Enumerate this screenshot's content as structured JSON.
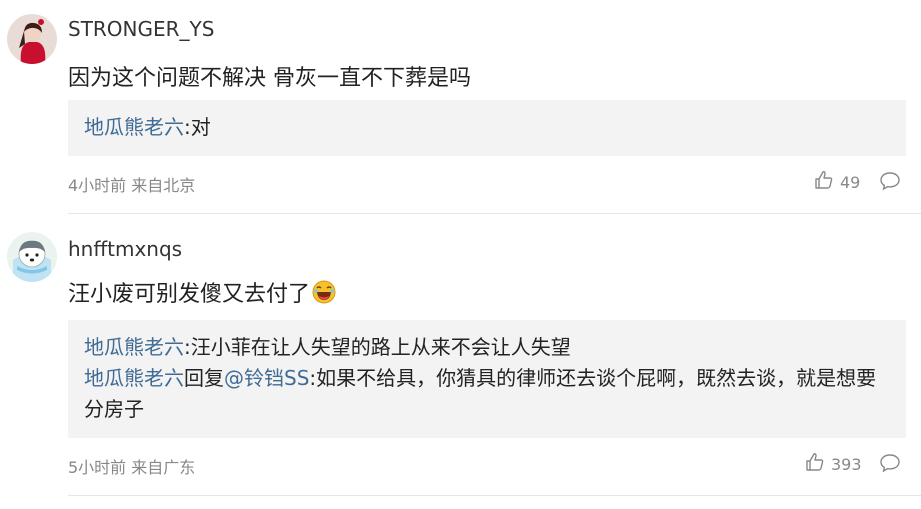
{
  "comments": [
    {
      "username": "STRONGER_YS",
      "text": "因为这个问题不解决 骨灰一直不下葬是吗",
      "replies": [
        {
          "author": "地瓜熊老六",
          "sep": ":",
          "text": "对"
        }
      ],
      "time": "4小时前",
      "location": "来自北京",
      "likes": "49"
    },
    {
      "username": "hnfftmxnqs",
      "text": "汪小废可别发傻又去付了",
      "replies": [
        {
          "author": "地瓜熊老六",
          "sep": ":",
          "text": "汪小菲在让人失望的路上从来不会让人失望"
        },
        {
          "author": "地瓜熊老六",
          "reply_word": "回复",
          "mention": "@铃铛SS",
          "sep": ":",
          "text": "如果不给具，你猜具的律师还去谈个屁啊，既然去谈，就是想要分房子"
        }
      ],
      "time": "5小时前",
      "location": "来自广东",
      "likes": "393"
    }
  ],
  "icons": {
    "like": "thumbs-up-icon",
    "comment": "speech-bubble-icon",
    "emoji": "laughing-emoji"
  },
  "colors": {
    "link": "#3f6b95",
    "meta": "#888888",
    "reply_bg": "#f3f3f3"
  }
}
